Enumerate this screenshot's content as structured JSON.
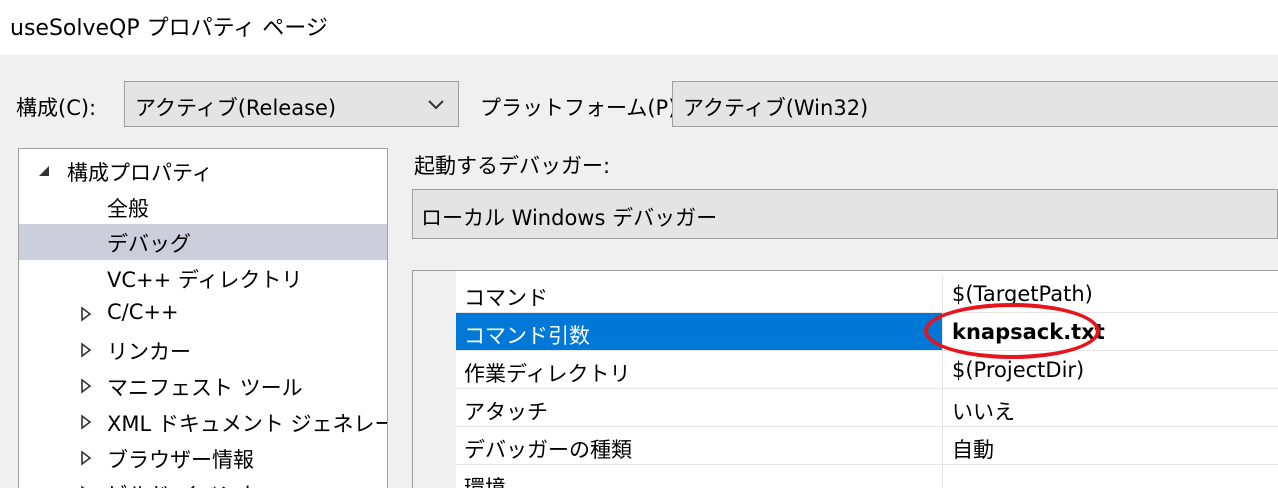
{
  "window": {
    "title": "useSolveQP プロパティ ページ"
  },
  "toolbar": {
    "config_label": "構成(C):",
    "config_value": "アクティブ(Release)",
    "platform_label": "プラットフォーム(P):",
    "platform_value": "アクティブ(Win32)"
  },
  "tree": {
    "items": [
      {
        "label": "構成プロパティ",
        "expanded": true
      },
      {
        "label": "全般"
      },
      {
        "label": "デバッグ",
        "selected": true
      },
      {
        "label": "VC++ ディレクトリ"
      },
      {
        "label": "C/C++",
        "collapsed": true
      },
      {
        "label": "リンカー",
        "collapsed": true
      },
      {
        "label": "マニフェスト ツール",
        "collapsed": true
      },
      {
        "label": "XML ドキュメント ジェネレーター",
        "collapsed": true
      },
      {
        "label": "ブラウザー情報",
        "collapsed": true
      },
      {
        "label": "ビルド イベント",
        "collapsed": true
      }
    ]
  },
  "debugger": {
    "label": "起動するデバッガー:",
    "value": "ローカル Windows デバッガー"
  },
  "properties": [
    {
      "name": "コマンド",
      "value": "$(TargetPath)"
    },
    {
      "name": "コマンド引数",
      "value": "knapsack.txt",
      "selected": true,
      "bold": true
    },
    {
      "name": "作業ディレクトリ",
      "value": "$(ProjectDir)"
    },
    {
      "name": "アタッチ",
      "value": "いいえ"
    },
    {
      "name": "デバッガーの種類",
      "value": "自動"
    },
    {
      "name": "環境",
      "value": ""
    }
  ],
  "icons": {
    "dropdown": "chevron-down-icon",
    "expanded": "triangle-expanded-icon",
    "collapsed": "triangle-collapsed-icon"
  },
  "colors": {
    "selection_blue": "#0078d7",
    "tree_selection": "#cccedb",
    "annotation_red": "#e8141b"
  }
}
